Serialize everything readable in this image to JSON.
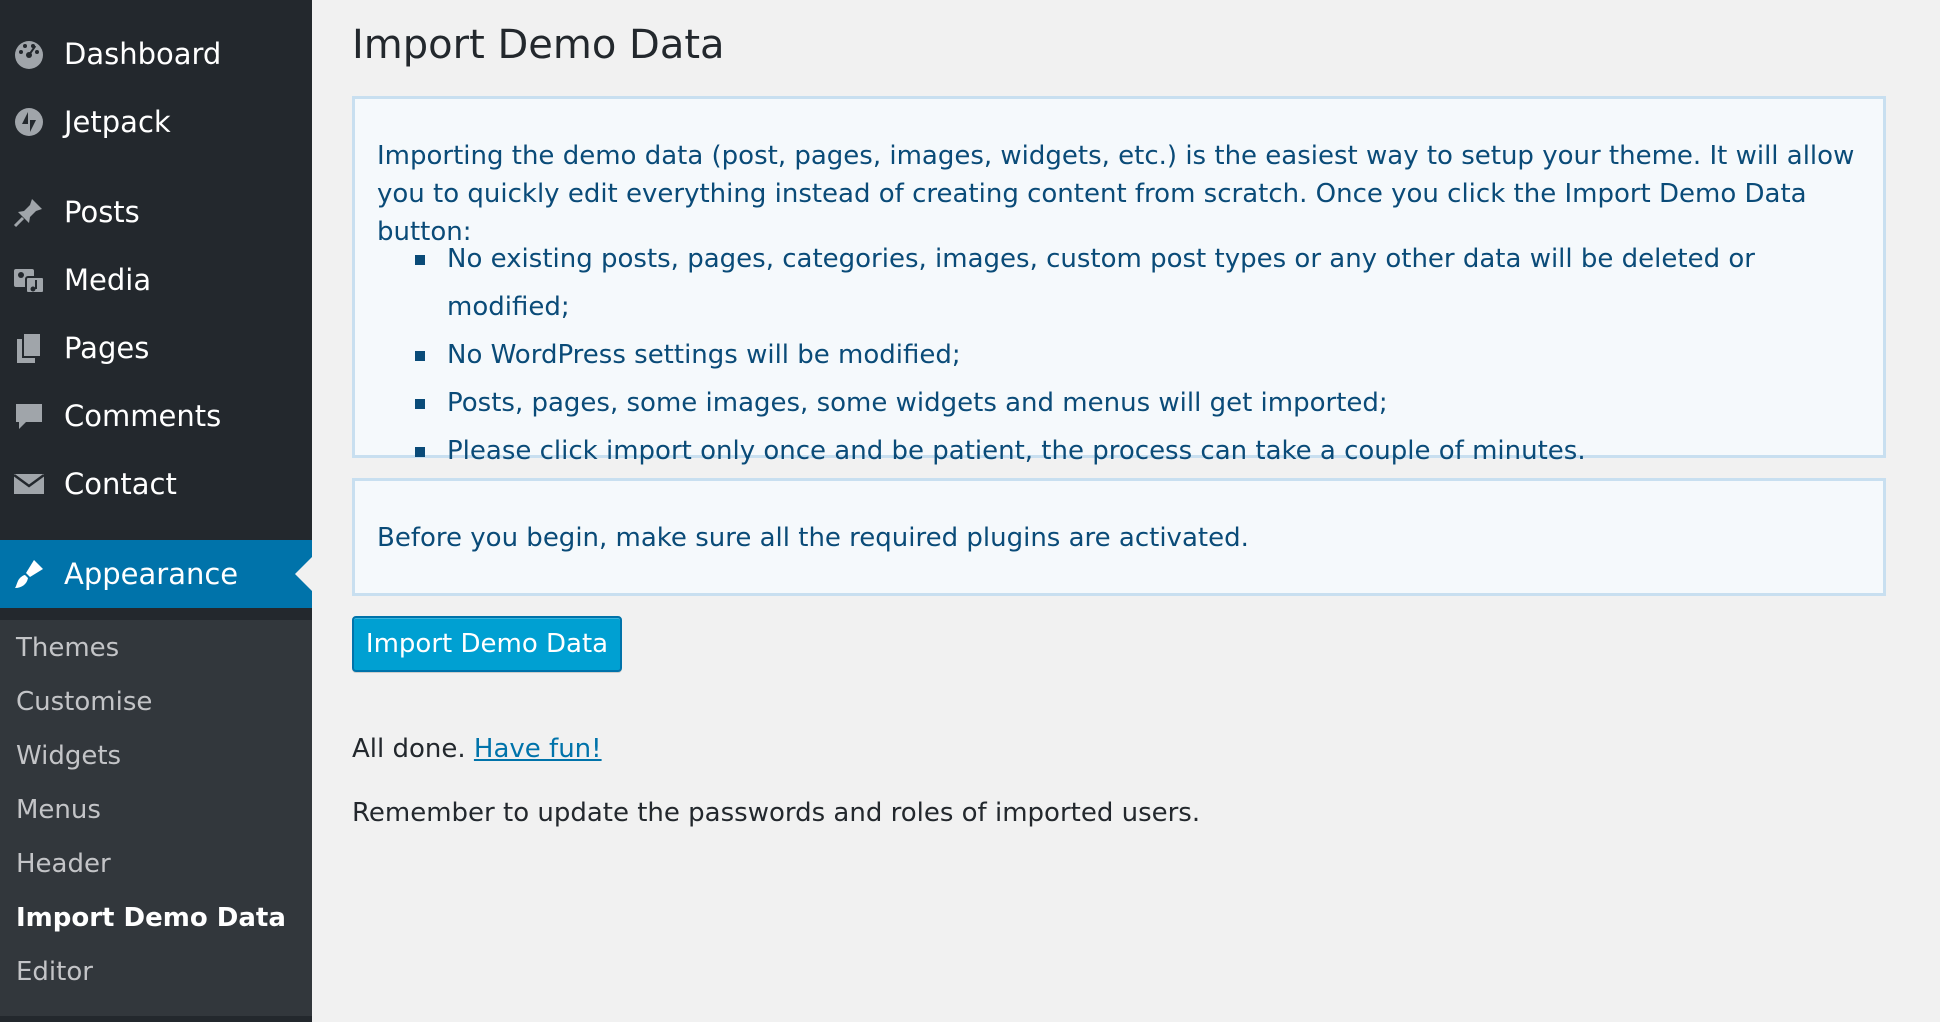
{
  "sidebar": {
    "menu": [
      {
        "label": "Dashboard",
        "icon": "dashboard-icon"
      },
      {
        "label": "Jetpack",
        "icon": "jetpack-icon"
      },
      {
        "label": "Posts",
        "icon": "pin-icon"
      },
      {
        "label": "Media",
        "icon": "media-icon"
      },
      {
        "label": "Pages",
        "icon": "pages-icon"
      },
      {
        "label": "Comments",
        "icon": "comment-icon"
      },
      {
        "label": "Contact",
        "icon": "envelope-icon"
      },
      {
        "label": "Appearance",
        "icon": "paintbrush-icon",
        "active": true
      }
    ],
    "submenu": [
      {
        "label": "Themes"
      },
      {
        "label": "Customise"
      },
      {
        "label": "Widgets"
      },
      {
        "label": "Menus"
      },
      {
        "label": "Header"
      },
      {
        "label": "Import Demo Data",
        "current": true
      },
      {
        "label": "Editor"
      }
    ]
  },
  "main": {
    "title": "Import Demo Data",
    "notice_1": {
      "intro": "Importing the demo data (post, pages, images, widgets, etc.) is the easiest way to setup your theme. It will allow you to quickly edit everything instead of creating content from scratch. Once you click the Import Demo Data button:",
      "bullets": [
        "No existing posts, pages, categories, images, custom post types or any other data will be deleted or modified;",
        "No WordPress settings will be modified;",
        "Posts, pages, some images, some widgets and menus will get imported;",
        "Please click import only once and be patient, the process can take a couple of minutes."
      ]
    },
    "notice_2": {
      "text": "Before you begin, make sure all the required plugins are activated."
    },
    "import_button_label": "Import Demo Data",
    "done_text": "All done.",
    "have_fun_link": "Have fun!",
    "remember_text": "Remember to update the passwords and roles of imported users."
  },
  "colors": {
    "sidebar_bg": "#23282d",
    "submenu_bg": "#32373c",
    "active_bg": "#0073aa",
    "button_bg": "#00a0d2",
    "notice_text": "#0a4b78"
  }
}
